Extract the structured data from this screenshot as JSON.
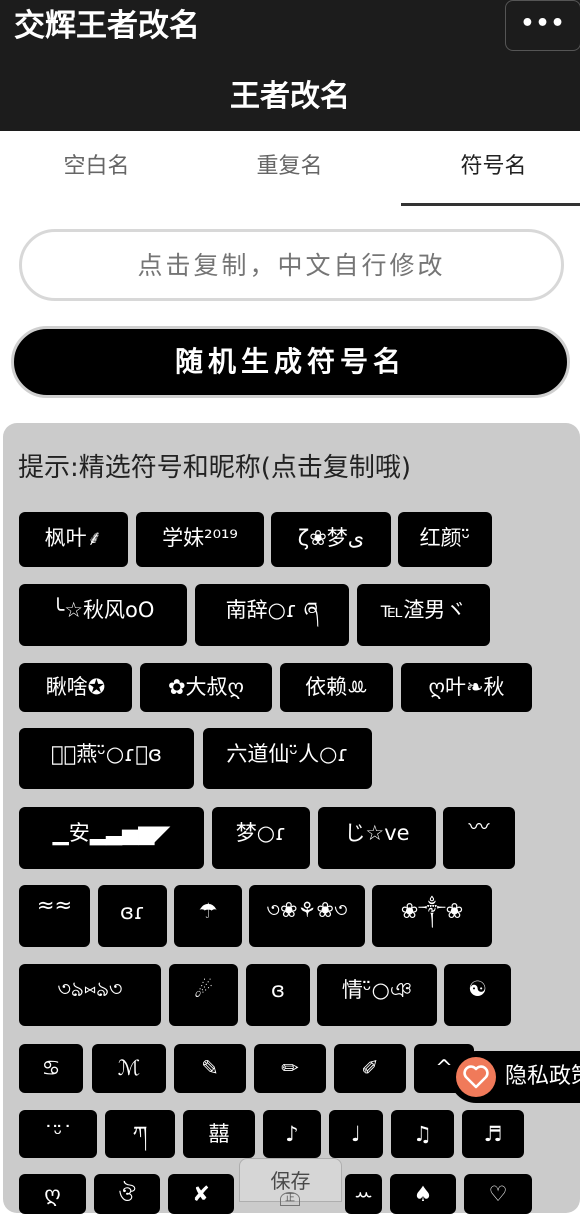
{
  "header": {
    "app_title": "交辉王者改名",
    "more_label": "•••",
    "page_title": "王者改名"
  },
  "tabs": [
    "空白名",
    "重复名",
    "符号名"
  ],
  "input": {
    "placeholder": "点击复制，中文自行修改"
  },
  "generate_label": "随机生成符号名",
  "hint": "提示:精选符号和昵称(点击复制哦)",
  "chips": [
    "枫叶⸙",
    "学妹²⁰¹⁹",
    "ζ❀梦ی",
    "红颜ᵕ̈",
    "╰☆秋风oO",
    "南辞○ɾ ཞ",
    "℡渣男ヾ",
    "瞅啥✪",
    "✿大叔ღ",
    "依赖ꔛ",
    "ღ叶❧秋",
    "ཞ⃝燕ᵕ̈○ɾ⃝ɞ",
    "六道仙ᵕ̈人○ɾ",
    "▁安▂▃▅▆◤",
    "梦○ɾ",
    "じ☆ve",
    "〰",
    "≈≈",
    "ɞɾ",
    "☂",
    "৩❀⚘❀৩",
    "❀༒❀",
    "৩ঌ⑅ঌ৩",
    "☄",
    "ɞ",
    "情ᵕ̈○ঞ",
    "☯",
    "♋",
    "ℳ",
    "✎",
    "✏",
    "✐",
    "^",
    "˙ᵕ̈˙",
    "ཀ",
    "囍",
    "♪",
    "♩",
    "♫",
    "♬",
    "ღ",
    "ঔ",
    "✘",
    "ꕀ",
    "♠",
    "♡"
  ],
  "privacy_label": "隐私政策",
  "save_label": "保存",
  "save_icon_label": "正"
}
